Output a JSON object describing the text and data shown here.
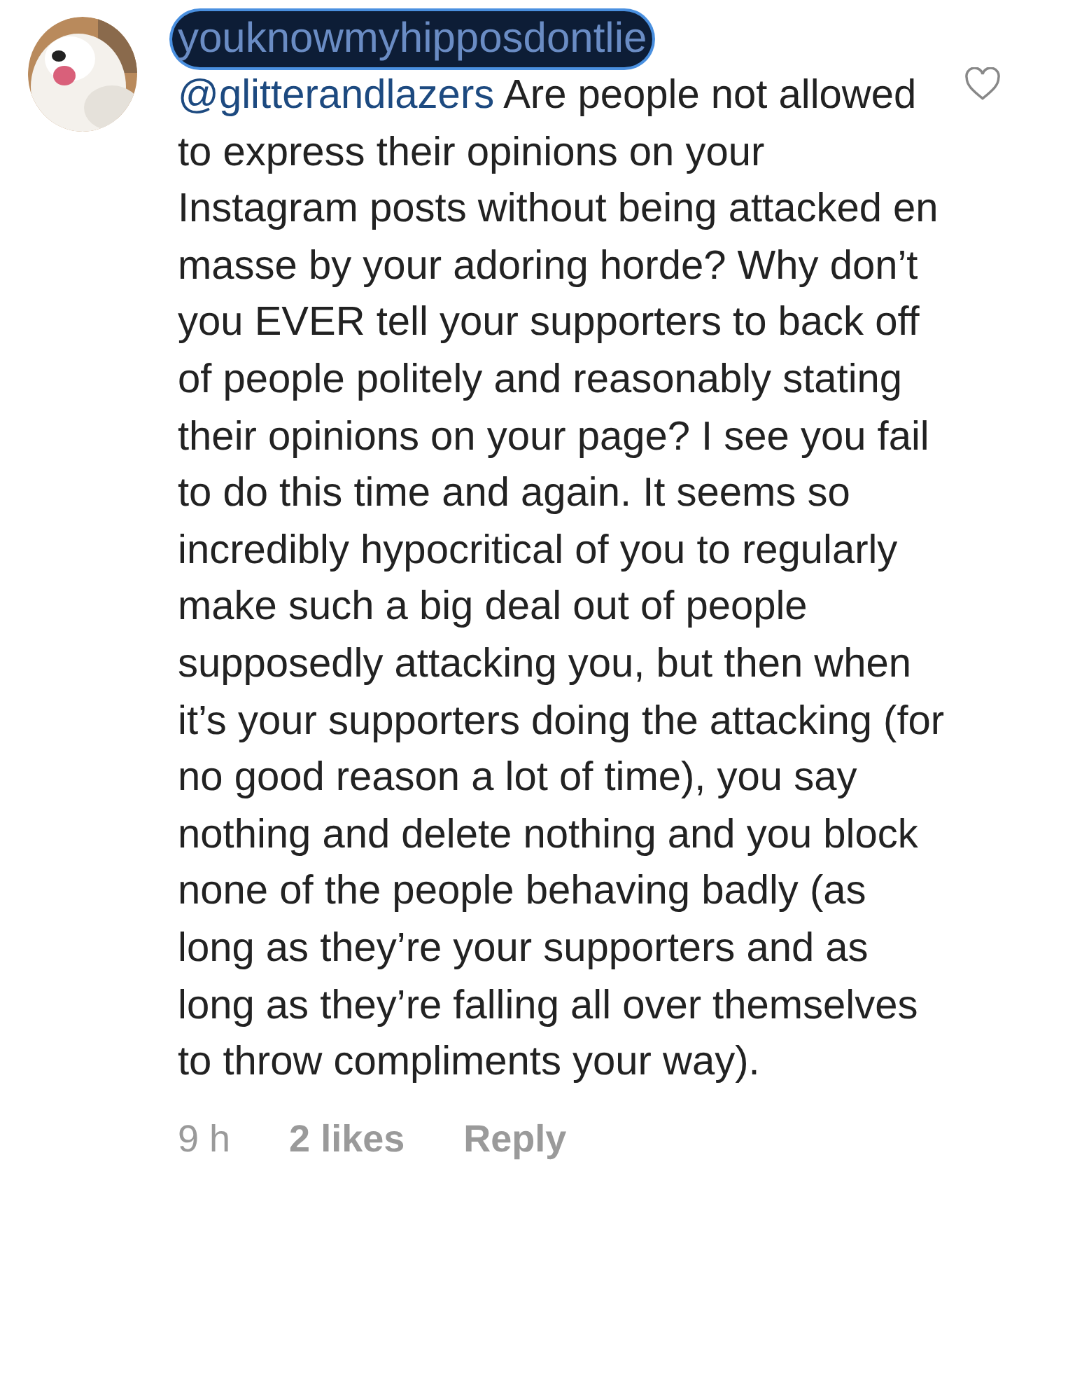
{
  "comment": {
    "username": "youknowmyhipposdontlie",
    "username_redacted": true,
    "mention": "@glitterandlazers",
    "text": "Are people not allowed to express their opinions on your Instagram posts without being attacked en masse by your adoring horde? Why don’t you EVER tell your supporters to back off of people politely and reasonably stating their opinions on your page? I see you fail to do this time and again. It seems so incredibly hypocritical of you to regularly make such a big deal out of people supposedly attacking you, but then when it’s your supporters doing the attacking (for no good reason a lot of time), you say nothing and delete nothing and you block none of the people behaving badly (as long as they’re your supporters and as long as they’re falling all over themselves to throw compliments your way).",
    "liked": false,
    "time": "9 h",
    "likes": "2 likes",
    "reply": "Reply"
  }
}
